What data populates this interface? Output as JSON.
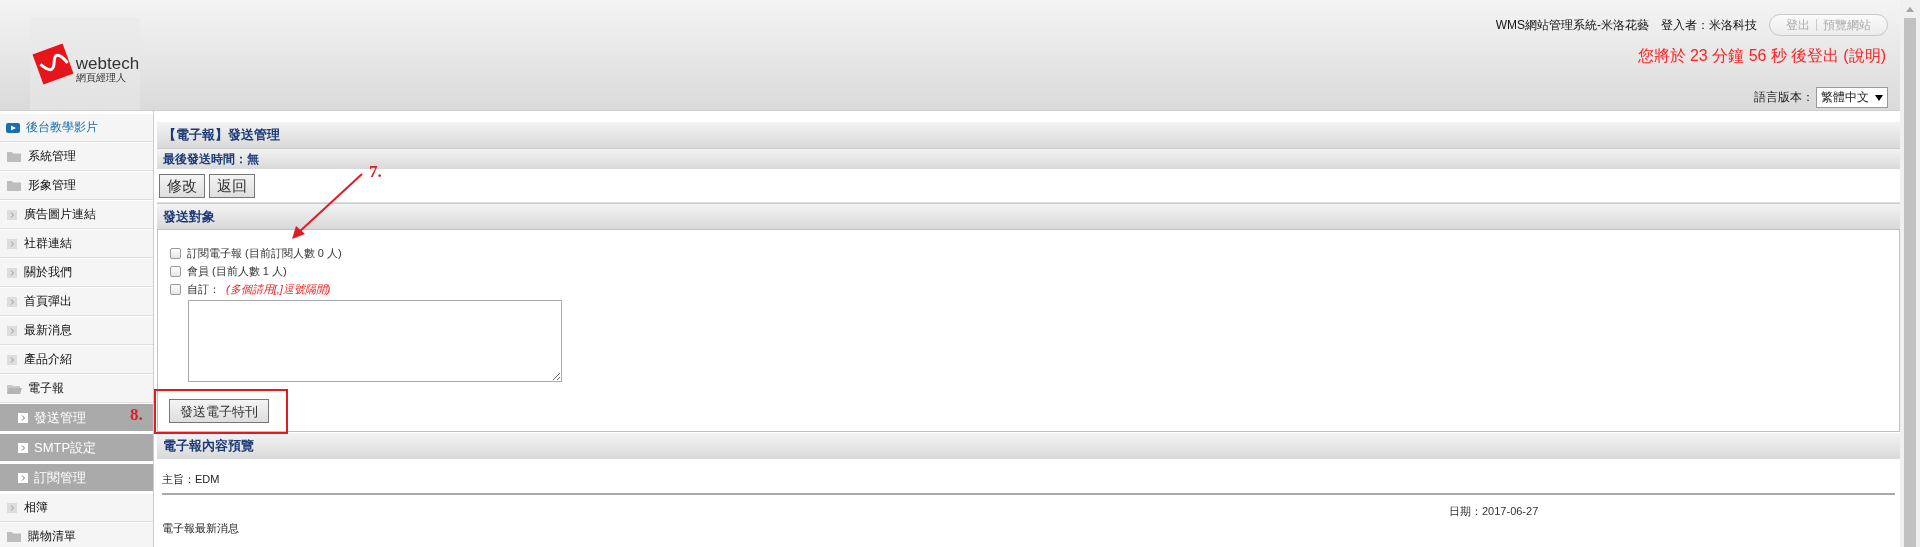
{
  "logo": {
    "brand": "webtech",
    "tagline": "網頁經理人"
  },
  "header": {
    "system_title": "WMS網站管理系統-米洛花藝",
    "login_label": "登入者：米洛科技",
    "buttons": [
      {
        "label": "登出"
      },
      {
        "label": "預覽網站"
      }
    ],
    "countdown": "您將於 23 分鐘 56 秒 後登出",
    "help_link": "(說明)",
    "language_label": "語言版本：",
    "language_value": "繁體中文"
  },
  "sidebar": {
    "items": [
      {
        "label": "後台教學影片",
        "kind": "video"
      },
      {
        "label": "系統管理",
        "kind": "folder",
        "expanded": false
      },
      {
        "label": "形象管理",
        "kind": "folder",
        "expanded": false
      },
      {
        "label": "廣告圖片連結",
        "kind": "page"
      },
      {
        "label": "社群連結",
        "kind": "page"
      },
      {
        "label": "關於我們",
        "kind": "page"
      },
      {
        "label": "首頁彈出",
        "kind": "page"
      },
      {
        "label": "最新消息",
        "kind": "page"
      },
      {
        "label": "產品介紹",
        "kind": "page"
      },
      {
        "label": "電子報",
        "kind": "folder",
        "expanded": true,
        "children": [
          {
            "label": "發送管理"
          },
          {
            "label": "SMTP設定"
          },
          {
            "label": "訂閱管理"
          }
        ]
      },
      {
        "label": "相簿",
        "kind": "page"
      },
      {
        "label": "購物清單",
        "kind": "folder",
        "expanded": false
      }
    ]
  },
  "main": {
    "page_title": "【電子報】發送管理",
    "last_sent": "最後發送時間：無",
    "actions": [
      {
        "label": "修改"
      },
      {
        "label": "返回"
      }
    ],
    "recipients": {
      "title": "發送對象",
      "options": [
        {
          "label": "訂閱電子報 (目前訂閱人數 0 人)",
          "checked": false
        },
        {
          "label": "會員 (目前人數 1 人)",
          "checked": false
        },
        {
          "label": "自訂：",
          "hint": "(多個請用[,]逗號隔開)",
          "checked": false
        }
      ],
      "send_button": "發送電子特刊"
    },
    "preview": {
      "title": "電子報內容預覽",
      "subject": "主旨：EDM",
      "date": "日期：2017-06-27",
      "body": "電子報最新消息"
    }
  },
  "annotations": [
    {
      "label": "7.",
      "kind": "arrow"
    },
    {
      "label": "8.",
      "kind": "box"
    }
  ]
}
